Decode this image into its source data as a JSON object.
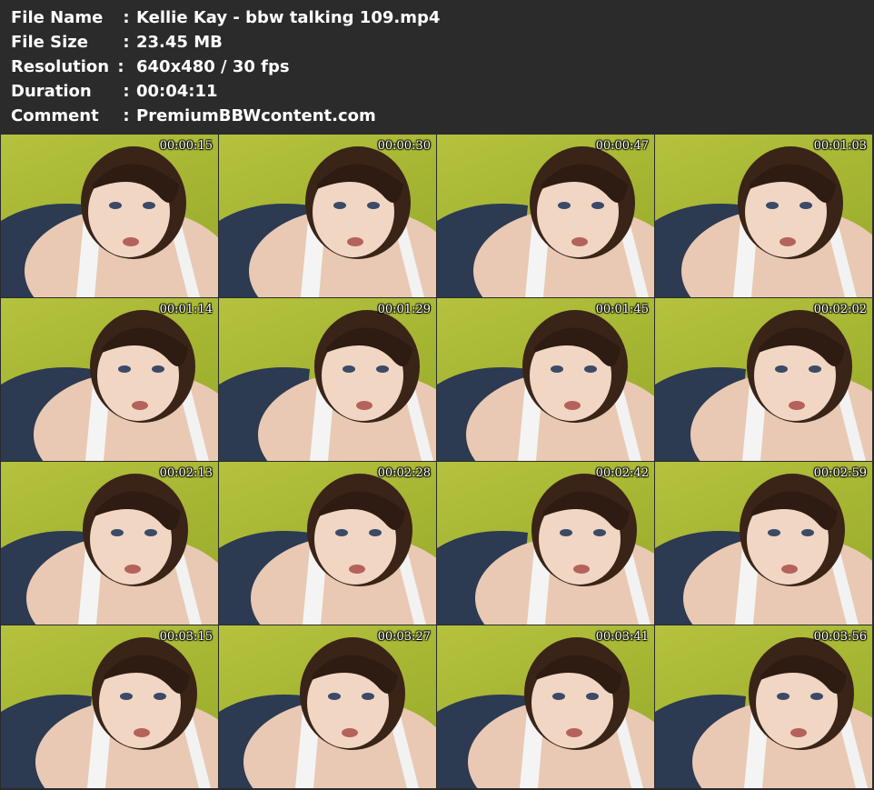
{
  "info": {
    "rows": [
      {
        "label": "File Name",
        "colon": ":",
        "value": "Kellie Kay - bbw talking 109.mp4"
      },
      {
        "label": "File Size",
        "colon": ":",
        "value": "23.45 MB"
      },
      {
        "label": "Resolution",
        "colon": ":",
        "value": "640x480 / 30 fps"
      },
      {
        "label": "Duration",
        "colon": ":",
        "value": "00:04:11"
      },
      {
        "label": "Comment",
        "colon": ":",
        "value": "PremiumBBWcontent.com"
      }
    ]
  },
  "thumbnails": [
    {
      "timestamp": "00:00:15"
    },
    {
      "timestamp": "00:00:30"
    },
    {
      "timestamp": "00:00:47"
    },
    {
      "timestamp": "00:01:03"
    },
    {
      "timestamp": "00:01:14"
    },
    {
      "timestamp": "00:01:29"
    },
    {
      "timestamp": "00:01:45"
    },
    {
      "timestamp": "00:02:02"
    },
    {
      "timestamp": "00:02:13"
    },
    {
      "timestamp": "00:02:28"
    },
    {
      "timestamp": "00:02:42"
    },
    {
      "timestamp": "00:02:59"
    },
    {
      "timestamp": "00:03:15"
    },
    {
      "timestamp": "00:03:27"
    },
    {
      "timestamp": "00:03:41"
    },
    {
      "timestamp": "00:03:56"
    }
  ],
  "colors": {
    "panel_background": "#2b2b2b",
    "text": "#ffffff",
    "backdrop_wall": "#b5c23e"
  }
}
